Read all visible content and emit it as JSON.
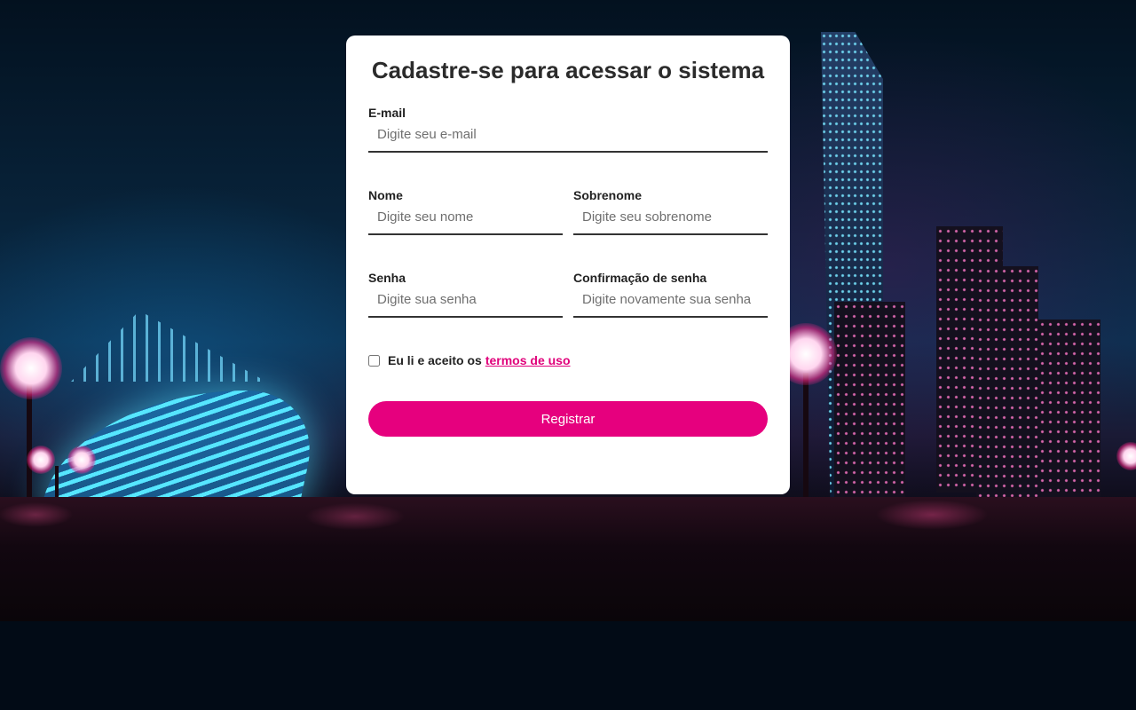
{
  "form": {
    "title": "Cadastre-se para acessar o sistema",
    "email": {
      "label": "E-mail",
      "placeholder": "Digite seu e-mail"
    },
    "first_name": {
      "label": "Nome",
      "placeholder": "Digite seu nome"
    },
    "last_name": {
      "label": "Sobrenome",
      "placeholder": "Digite seu sobrenome"
    },
    "password": {
      "label": "Senha",
      "placeholder": "Digite sua senha"
    },
    "password_confirm": {
      "label": "Confirmação de senha",
      "placeholder": "Digite novamente sua senha"
    },
    "terms": {
      "text": "Eu li e aceito os",
      "link": "termos de uso",
      "checked": false
    },
    "submit_label": "Registrar"
  },
  "colors": {
    "accent": "#e6007e",
    "card_background": "#ffffff",
    "title_text": "#2b2b2b"
  }
}
